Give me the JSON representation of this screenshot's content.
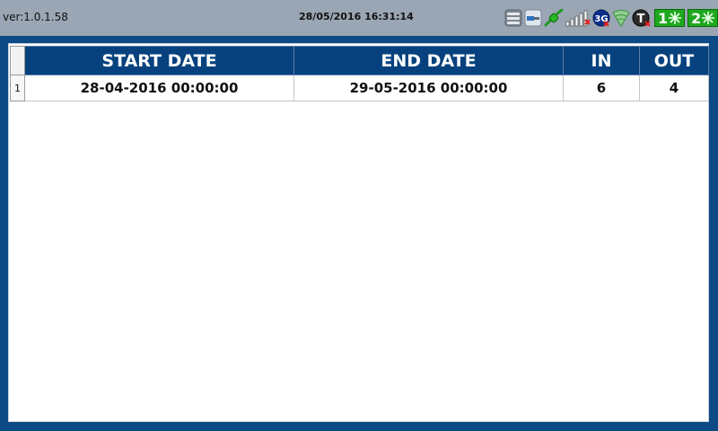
{
  "status_bar": {
    "version": "ver:1.0.1.58",
    "datetime": "28/05/2016 16:31:14",
    "icons": [
      "storage-icon",
      "usb-icon",
      "network-plug-icon",
      "signal-bars-icon",
      "3g-icon",
      "wifi-icon",
      "t-icon",
      "sim1-icon",
      "sim2-icon"
    ],
    "network_badge": "3G",
    "t_badge": "T",
    "sim1_label": "1",
    "sim2_label": "2"
  },
  "table": {
    "columns": [
      "START DATE",
      "END DATE",
      "IN",
      "OUT"
    ],
    "rows": [
      {
        "index": "1",
        "start_date": "28-04-2016 00:00:00",
        "end_date": "29-05-2016 00:00:00",
        "in": "6",
        "out": "4"
      }
    ]
  },
  "colors": {
    "background": "#0c4a86",
    "status_bar": "#9aa6b3",
    "header": "#07427e",
    "sim_green": "#1fa81f"
  }
}
